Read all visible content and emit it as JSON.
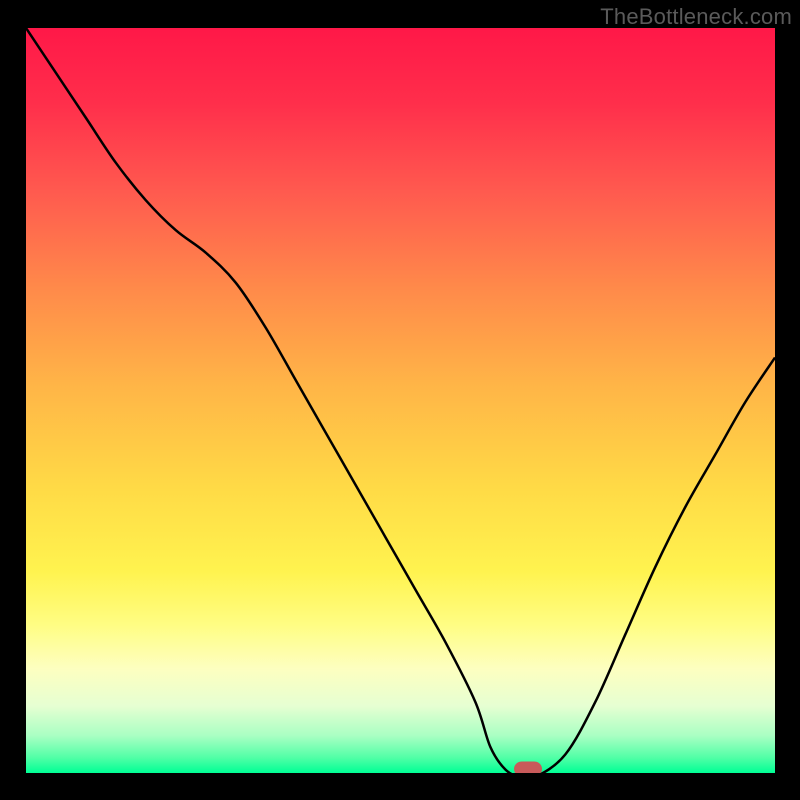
{
  "watermark": "TheBottleneck.com",
  "chart_data": {
    "type": "line",
    "title": "",
    "xlabel": "",
    "ylabel": "",
    "xlim": [
      0,
      100
    ],
    "ylim": [
      0,
      100
    ],
    "x": [
      0,
      4,
      8,
      12,
      16,
      20,
      24,
      28,
      32,
      36,
      40,
      44,
      48,
      52,
      56,
      60,
      62,
      64,
      66,
      68,
      72,
      76,
      80,
      84,
      88,
      92,
      96,
      100
    ],
    "values": [
      100,
      94,
      88,
      82,
      77,
      73,
      70,
      66,
      60,
      53,
      46,
      39,
      32,
      25,
      18,
      10,
      4,
      1,
      0,
      0,
      3,
      10,
      19,
      28,
      36,
      43,
      50,
      56
    ],
    "marker": {
      "x": 67,
      "y": 0
    },
    "gradient_stops": [
      {
        "pos": 0,
        "color": "#ff1848"
      },
      {
        "pos": 50,
        "color": "#ffdb46"
      },
      {
        "pos": 85,
        "color": "#fdffc0"
      },
      {
        "pos": 100,
        "color": "#00ff95"
      }
    ]
  },
  "colors": {
    "frame": "#000000",
    "curve": "#000000",
    "marker": "#c85a5a",
    "watermark_text": "#5a5a5a"
  }
}
